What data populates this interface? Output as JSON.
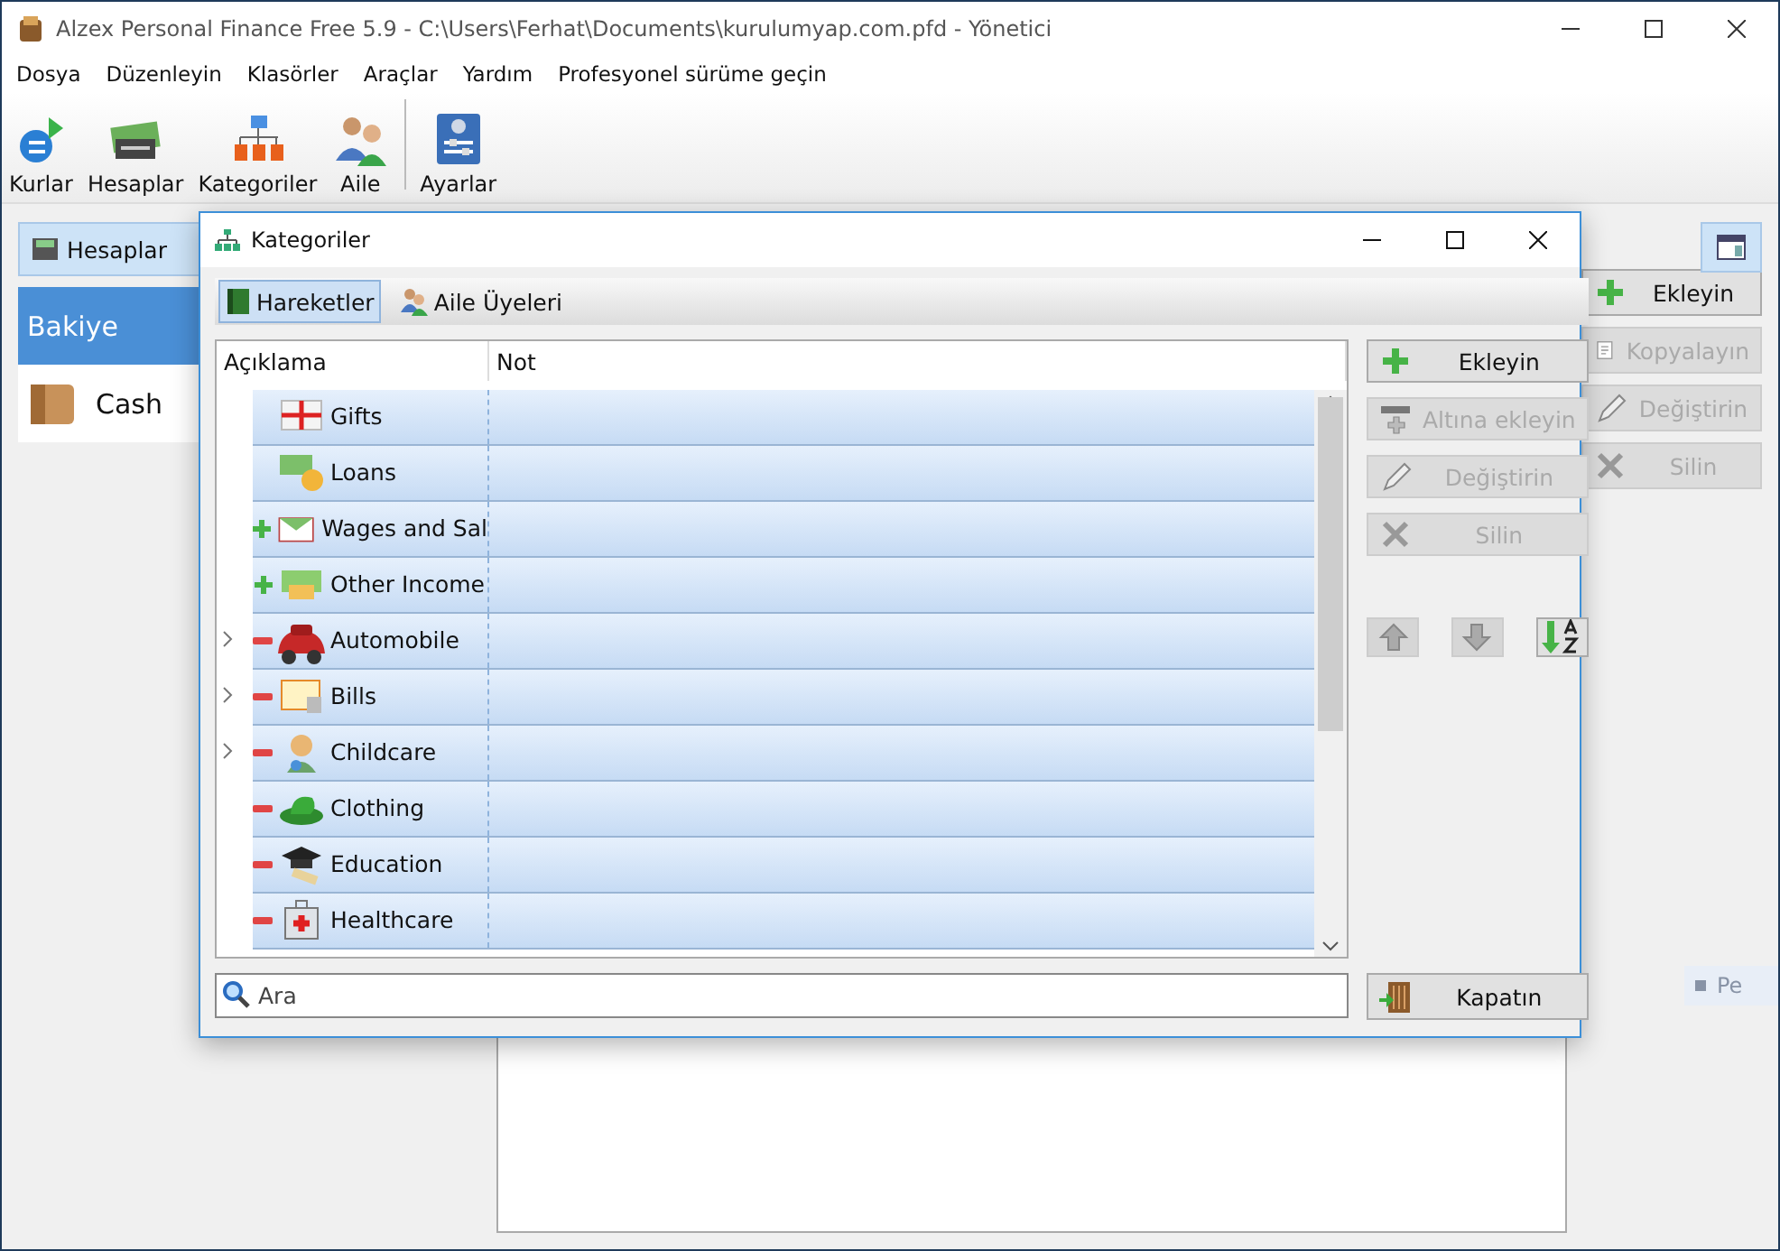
{
  "window": {
    "title": "Alzex Personal Finance Free 5.9 - C:\\Users\\Ferhat\\Documents\\kurulumyap.com.pfd - Yönetici"
  },
  "menu": [
    "Dosya",
    "Düzenleyin",
    "Klasörler",
    "Araçlar",
    "Yardım",
    "Profesyonel sürüme geçin"
  ],
  "toolbar": [
    {
      "label": "Kurlar"
    },
    {
      "label": "Hesaplar"
    },
    {
      "label": "Kategoriler"
    },
    {
      "label": "Aile"
    },
    {
      "label": "Ayarlar"
    }
  ],
  "accounts_button": {
    "label": "Hesaplar"
  },
  "accounts": [
    {
      "label": "Bakiye",
      "selected": true
    },
    {
      "label": "Cash",
      "selected": false
    }
  ],
  "side_buttons": [
    {
      "label": "Ekleyin",
      "disabled": false
    },
    {
      "label": "Kopyalayın",
      "disabled": true
    },
    {
      "label": "Değiştirin",
      "disabled": true
    },
    {
      "label": "Silin",
      "disabled": true
    }
  ],
  "faint_chip": "Pe",
  "dialog": {
    "title": "Kategoriler",
    "tabs": [
      {
        "label": "Hareketler",
        "selected": true
      },
      {
        "label": "Aile Üyeleri",
        "selected": false
      }
    ],
    "columns": [
      "Açıklama",
      "Not"
    ],
    "rows": [
      {
        "name": "Gifts",
        "kind": "none",
        "expandable": false,
        "selected": true
      },
      {
        "name": "Loans",
        "kind": "none",
        "expandable": false,
        "selected": true
      },
      {
        "name": "Wages and Sal",
        "kind": "plus",
        "expandable": false,
        "selected": true
      },
      {
        "name": "Other Income",
        "kind": "plus",
        "expandable": false,
        "selected": true
      },
      {
        "name": "Automobile",
        "kind": "minus",
        "expandable": true,
        "selected": true
      },
      {
        "name": "Bills",
        "kind": "minus",
        "expandable": true,
        "selected": true
      },
      {
        "name": "Childcare",
        "kind": "minus",
        "expandable": true,
        "selected": true
      },
      {
        "name": "Clothing",
        "kind": "minus",
        "expandable": false,
        "selected": true
      },
      {
        "name": "Education",
        "kind": "minus",
        "expandable": false,
        "selected": true
      },
      {
        "name": "Healthcare",
        "kind": "minus",
        "expandable": false,
        "selected": true
      }
    ],
    "buttons": [
      {
        "label": "Ekleyin",
        "disabled": false
      },
      {
        "label": "Altına ekleyin",
        "disabled": true
      },
      {
        "label": "Değiştirin",
        "disabled": true
      },
      {
        "label": "Silin",
        "disabled": true
      }
    ],
    "move_buttons": [
      {
        "kind": "up",
        "disabled": true
      },
      {
        "kind": "down",
        "disabled": true
      },
      {
        "kind": "sort",
        "disabled": false
      }
    ],
    "search": {
      "placeholder": "Ara"
    },
    "close_button": {
      "label": "Kapatın"
    }
  }
}
